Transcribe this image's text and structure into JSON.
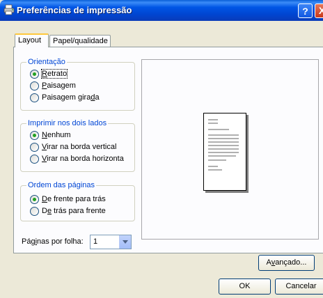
{
  "window": {
    "title": "Preferências de impressão",
    "help_label": "?",
    "close_label": "X"
  },
  "tabs": [
    {
      "label": "Layout",
      "active": true
    },
    {
      "label": "Papel/qualidade",
      "active": false
    }
  ],
  "orientation": {
    "legend": "Orientação",
    "options": [
      {
        "pre": "",
        "key": "R",
        "post": "etrato",
        "checked": true
      },
      {
        "pre": "",
        "key": "P",
        "post": "aisagem",
        "checked": false
      },
      {
        "pre": "Paisagem gira",
        "key": "d",
        "post": "a",
        "checked": false
      }
    ]
  },
  "duplex": {
    "legend": "Imprimir nos dois lados",
    "options": [
      {
        "pre": "",
        "key": "N",
        "post": "enhum",
        "checked": true
      },
      {
        "pre": "",
        "key": "V",
        "post": "irar na borda vertical",
        "checked": false
      },
      {
        "pre": "",
        "key": "V",
        "post": "irar na borda horizonta",
        "checked": false
      }
    ]
  },
  "page_order": {
    "legend": "Ordem das páginas",
    "options": [
      {
        "pre": "",
        "key": "D",
        "post": "e frente para trás",
        "checked": true
      },
      {
        "pre": "D",
        "key": "e",
        "post": " trás para frente",
        "checked": false
      }
    ]
  },
  "pages_per_sheet": {
    "label_pre": "Pág",
    "label_key": "i",
    "label_post": "nas por folha:",
    "value": "1"
  },
  "buttons": {
    "advanced_pre": "A",
    "advanced_key": "v",
    "advanced_post": "ançado...",
    "ok": "OK",
    "cancel": "Cancelar"
  },
  "colors": {
    "titlebar": "#0055e5",
    "dialog_bg": "#ece9d8",
    "group_legend": "#0046d5",
    "radio_dot": "#21a121"
  }
}
